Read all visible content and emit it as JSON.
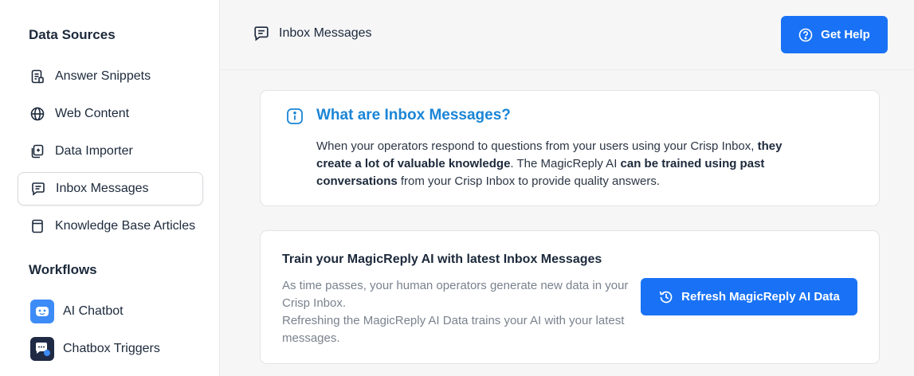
{
  "sidebar": {
    "data_sources_title": "Data Sources",
    "items": [
      {
        "label": "Answer Snippets",
        "icon": "document-list-icon"
      },
      {
        "label": "Web Content",
        "icon": "globe-icon"
      },
      {
        "label": "Data Importer",
        "icon": "import-icon"
      },
      {
        "label": "Inbox Messages",
        "icon": "message-icon",
        "active": true
      },
      {
        "label": "Knowledge Base Articles",
        "icon": "book-icon"
      }
    ],
    "workflows_title": "Workflows",
    "workflows": [
      {
        "label": "AI Chatbot",
        "icon": "robot-icon",
        "color": "#3d8bf7"
      },
      {
        "label": "Chatbox Triggers",
        "icon": "chat-trigger-icon",
        "color": "#1f2a44"
      }
    ]
  },
  "header": {
    "title": "Inbox Messages",
    "help_button": "Get Help"
  },
  "info": {
    "title": "What are Inbox Messages?",
    "body_1": "When your operators respond to questions from your users using your Crisp Inbox, ",
    "body_bold_1": "they create a lot of valuable knowledge",
    "body_2": ". The MagicReply AI ",
    "body_bold_2": "can be trained using past conversations",
    "body_3": " from your Crisp Inbox to provide quality answers."
  },
  "train": {
    "title": "Train your MagicReply AI with latest Inbox Messages",
    "desc_1": "As time passes, your human operators generate new data in your Crisp Inbox.",
    "desc_2": "Refreshing the MagicReply AI Data trains your AI with your latest messages.",
    "button": "Refresh MagicReply AI Data"
  },
  "colors": {
    "primary": "#1972f5",
    "info_title": "#1a85d6"
  }
}
